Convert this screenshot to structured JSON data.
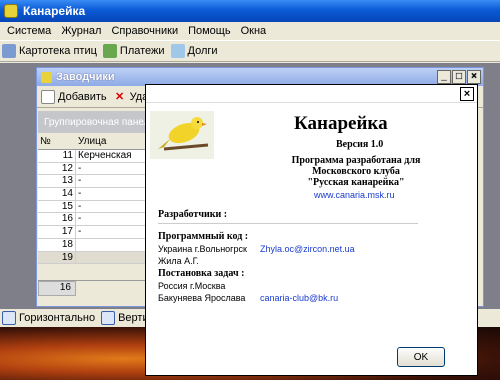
{
  "app": {
    "title": "Канарейка"
  },
  "menu": [
    "Система",
    "Журнал",
    "Справочники",
    "Помощь",
    "Окна"
  ],
  "toolbar": {
    "cards": "Картотека птиц",
    "payments": "Платежи",
    "debts": "Долги"
  },
  "child": {
    "title": "Заводчики",
    "add": "Добавить",
    "delete": "Удали",
    "group_panel": "Группировочная панель",
    "columns": [
      "№",
      "Улица"
    ],
    "rows": [
      {
        "num": "11",
        "street": "Керченская"
      },
      {
        "num": "12",
        "street": "-"
      },
      {
        "num": "13",
        "street": "-"
      },
      {
        "num": "14",
        "street": "-"
      },
      {
        "num": "15",
        "street": "-"
      },
      {
        "num": "16",
        "street": "-"
      },
      {
        "num": "17",
        "street": "-"
      },
      {
        "num": "18",
        "street": ""
      },
      {
        "num": "19",
        "street": ""
      }
    ],
    "footer_count": "16"
  },
  "bottombar": {
    "horizontal": "Горизонтально",
    "vertical": "Вертикаль"
  },
  "about": {
    "name": "Канарейка",
    "version": "Версия 1.0",
    "desc1": "Программа разработана для",
    "desc2": "Московского клуба",
    "desc3": "\"Русская канарейка\"",
    "url": "www.canaria.msk.ru",
    "dev_head": "Разработчики :",
    "code_head": "Программный код :",
    "code1_name": "Украина г.Вольногрск",
    "code1_mail": "Zhyla.oc@zircon.net.ua",
    "code2_name": "Жила А.Г.",
    "task_head": "Постановка задач :",
    "task1": "Россия г.Москва",
    "task2_name": "Бакуняева Ярослава",
    "task2_mail": "canaria-club@bk.ru",
    "ok": "OK",
    "close": "×"
  }
}
